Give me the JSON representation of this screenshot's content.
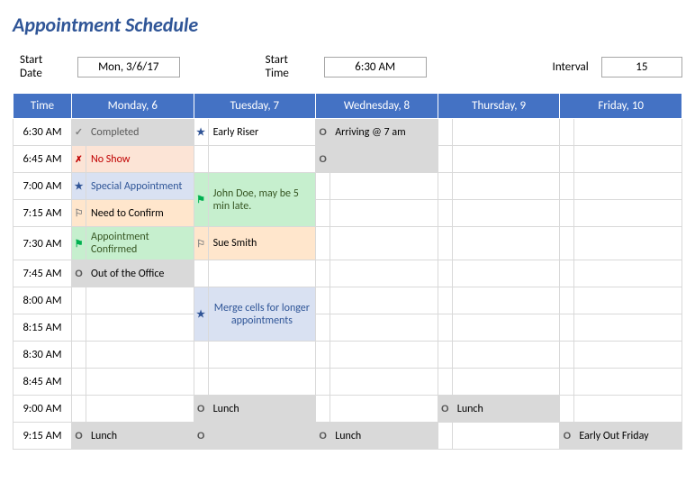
{
  "title": "Appointment Schedule",
  "controls": {
    "start_date_label": "Start Date",
    "start_date_value": "Mon, 3/6/17",
    "start_time_label": "Start Time",
    "start_time_value": "6:30 AM",
    "interval_label": "Interval",
    "interval_value": "15"
  },
  "headers": {
    "time": "Time",
    "monday": "Monday, 6",
    "tuesday": "Tuesday, 7",
    "wednesday": "Wednesday, 8",
    "thursday": "Thursday, 9",
    "friday": "Friday, 10"
  },
  "times": [
    "6:30 AM",
    "6:45 AM",
    "7:00 AM",
    "7:15 AM",
    "7:30 AM",
    "7:45 AM",
    "8:00 AM",
    "8:15 AM",
    "8:30 AM",
    "8:45 AM",
    "9:00 AM",
    "9:15 AM"
  ],
  "appts": {
    "mon_completed": "Completed",
    "mon_noshow": "No Show",
    "mon_special": "Special Appointment",
    "mon_confirm": "Need to Confirm",
    "mon_confirmed": "Appointment Confirmed",
    "mon_out": "Out of the Office",
    "mon_lunch": "Lunch",
    "tue_early": "Early Riser",
    "tue_john": "John Doe, may be 5 min late.",
    "tue_sue": "Sue Smith",
    "tue_merge": "Merge cells for longer appointments",
    "tue_lunch": "Lunch",
    "wed_arrive": "Arriving @ 7 am",
    "wed_lunch": "Lunch",
    "thu_lunch": "Lunch",
    "fri_early": "Early Out Friday"
  },
  "icons": {
    "check": "✓",
    "x": "✗",
    "star": "★",
    "flag": "⚑",
    "flag_o": "⚐",
    "circle": "O"
  }
}
